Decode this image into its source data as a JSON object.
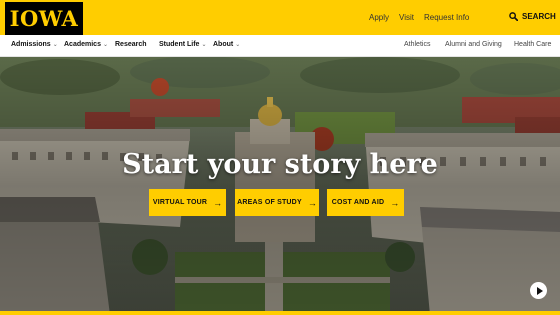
{
  "brand": {
    "logo_text": "IOWA",
    "accent": "#ffcd00",
    "text_on_accent": "#111111"
  },
  "utility_nav": {
    "links": [
      {
        "label": "Apply"
      },
      {
        "label": "Visit"
      },
      {
        "label": "Request Info"
      }
    ],
    "search": {
      "label": "SEARCH",
      "icon": "search-icon"
    }
  },
  "main_nav": {
    "items": [
      {
        "label": "Admissions",
        "has_dropdown": true
      },
      {
        "label": "Academics",
        "has_dropdown": true
      },
      {
        "label": "Research",
        "has_dropdown": false
      },
      {
        "label": "Student Life",
        "has_dropdown": true
      },
      {
        "label": "About",
        "has_dropdown": true
      }
    ],
    "secondary": [
      {
        "label": "Athletics"
      },
      {
        "label": "Alumni and Giving"
      },
      {
        "label": "Health Care"
      }
    ],
    "dropdown_icon": "chevron-down-icon"
  },
  "hero": {
    "headline": "Start your story here",
    "ctas": [
      {
        "label": "VIRTUAL TOUR"
      },
      {
        "label": "AREAS OF STUDY"
      },
      {
        "label": "COST AND AID"
      }
    ],
    "cta_icon": "arrow-right-icon",
    "video_control": {
      "icon": "play-icon"
    }
  }
}
